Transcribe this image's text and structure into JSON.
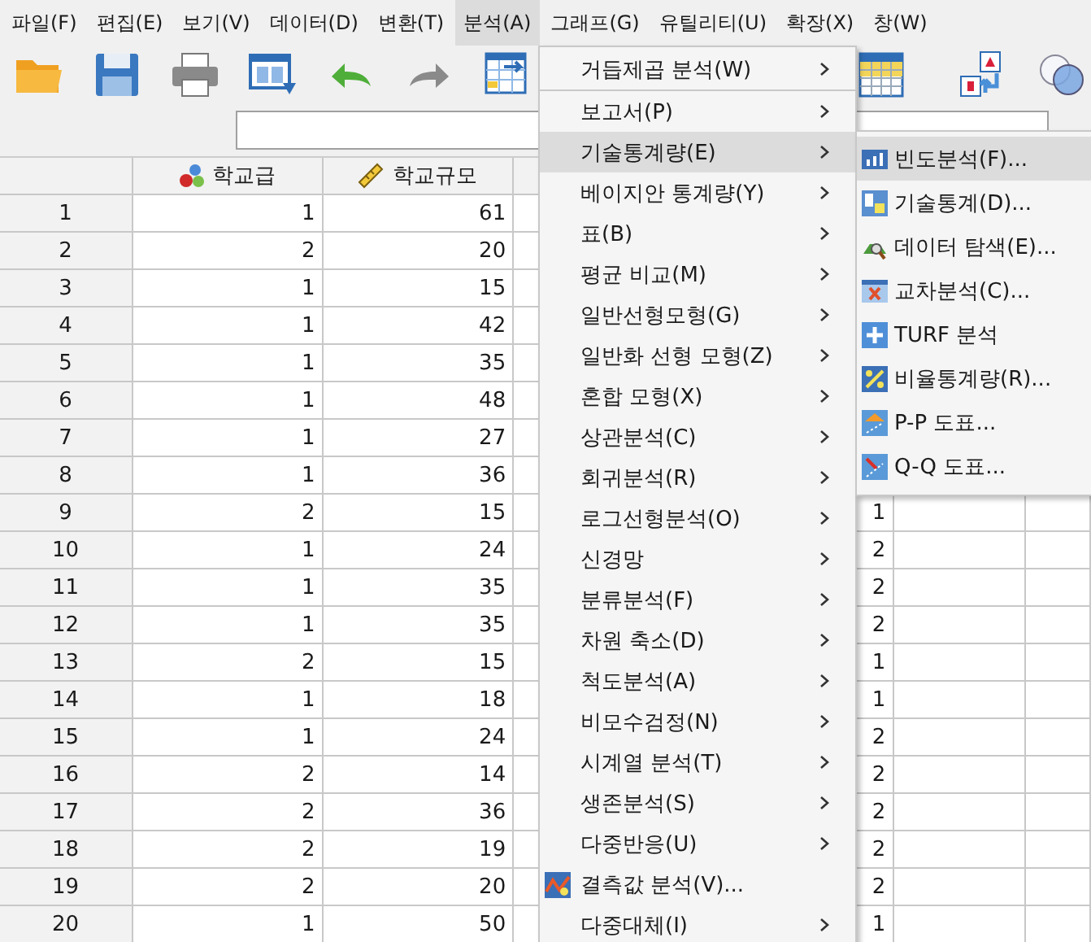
{
  "menu_bar": [
    {
      "label": "파일(F)",
      "selected": false
    },
    {
      "label": "편집(E)",
      "selected": false
    },
    {
      "label": "보기(V)",
      "selected": false
    },
    {
      "label": "데이터(D)",
      "selected": false
    },
    {
      "label": "변환(T)",
      "selected": false
    },
    {
      "label": "분석(A)",
      "selected": true
    },
    {
      "label": "그래프(G)",
      "selected": false
    },
    {
      "label": "유틸리티(U)",
      "selected": false
    },
    {
      "label": "확장(X)",
      "selected": false
    },
    {
      "label": "창(W)",
      "selected": false
    }
  ],
  "grid": {
    "columns": [
      {
        "name": "학교급",
        "kind": "nominal"
      },
      {
        "name": "학교규모",
        "kind": "scale"
      }
    ],
    "rows": [
      {
        "number": "1",
        "cells": [
          "1",
          "61"
        ]
      },
      {
        "number": "2",
        "cells": [
          "2",
          "20"
        ]
      },
      {
        "number": "3",
        "cells": [
          "1",
          "15"
        ]
      },
      {
        "number": "4",
        "cells": [
          "1",
          "42"
        ]
      },
      {
        "number": "5",
        "cells": [
          "1",
          "35"
        ]
      },
      {
        "number": "6",
        "cells": [
          "1",
          "48"
        ]
      },
      {
        "number": "7",
        "cells": [
          "1",
          "27"
        ]
      },
      {
        "number": "8",
        "cells": [
          "1",
          "36"
        ]
      },
      {
        "number": "9",
        "cells": [
          "2",
          "15"
        ],
        "column_4": "1"
      },
      {
        "number": "10",
        "cells": [
          "1",
          "24"
        ],
        "column_4": "2"
      },
      {
        "number": "11",
        "cells": [
          "1",
          "35"
        ],
        "column_4": "2"
      },
      {
        "number": "12",
        "cells": [
          "1",
          "35"
        ],
        "column_4": "2"
      },
      {
        "number": "13",
        "cells": [
          "2",
          "15"
        ],
        "column_4": "1"
      },
      {
        "number": "14",
        "cells": [
          "1",
          "18"
        ],
        "column_4": "1"
      },
      {
        "number": "15",
        "cells": [
          "1",
          "24"
        ],
        "column_4": "2"
      },
      {
        "number": "16",
        "cells": [
          "2",
          "14"
        ],
        "column_4": "2"
      },
      {
        "number": "17",
        "cells": [
          "2",
          "36"
        ],
        "column_4": "2"
      },
      {
        "number": "18",
        "cells": [
          "2",
          "19"
        ],
        "column_4": "2"
      },
      {
        "number": "19",
        "cells": [
          "2",
          "20"
        ],
        "column_4": "2"
      },
      {
        "number": "20",
        "cells": [
          "1",
          "50"
        ],
        "column_4": "1"
      }
    ]
  },
  "analyze_menu": {
    "sections": [
      [
        {
          "label": "거듭제곱 분석(W)",
          "submenu": true,
          "selected": false
        }
      ],
      [
        {
          "label": "보고서(P)",
          "submenu": true,
          "selected": false
        },
        {
          "label": "기술통계량(E)",
          "submenu": true,
          "selected": true
        },
        {
          "label": "베이지안 통계량(Y)",
          "submenu": true,
          "selected": false
        },
        {
          "label": "표(B)",
          "submenu": true,
          "selected": false
        },
        {
          "label": "평균 비교(M)",
          "submenu": true,
          "selected": false
        },
        {
          "label": "일반선형모형(G)",
          "submenu": true,
          "selected": false
        },
        {
          "label": "일반화 선형 모형(Z)",
          "submenu": true,
          "selected": false
        },
        {
          "label": "혼합 모형(X)",
          "submenu": true,
          "selected": false
        },
        {
          "label": "상관분석(C)",
          "submenu": true,
          "selected": false
        },
        {
          "label": "회귀분석(R)",
          "submenu": true,
          "selected": false
        },
        {
          "label": "로그선형분석(O)",
          "submenu": true,
          "selected": false
        },
        {
          "label": "신경망",
          "submenu": true,
          "selected": false
        },
        {
          "label": "분류분석(F)",
          "submenu": true,
          "selected": false
        },
        {
          "label": "차원 축소(D)",
          "submenu": true,
          "selected": false
        },
        {
          "label": "척도분석(A)",
          "submenu": true,
          "selected": false
        },
        {
          "label": "비모수검정(N)",
          "submenu": true,
          "selected": false
        },
        {
          "label": "시계열 분석(T)",
          "submenu": true,
          "selected": false
        },
        {
          "label": "생존분석(S)",
          "submenu": true,
          "selected": false
        },
        {
          "label": "다중반응(U)",
          "submenu": true,
          "selected": false
        },
        {
          "label": "결측값 분석(V)...",
          "submenu": false,
          "selected": false,
          "kind": "missing"
        },
        {
          "label": "다중대체(I)",
          "submenu": true,
          "selected": false
        }
      ]
    ]
  },
  "descriptives_submenu": {
    "items": [
      {
        "label": "빈도분석(F)...",
        "kind": "frequencies",
        "selected": true
      },
      {
        "label": "기술통계(D)...",
        "kind": "descriptives",
        "selected": false
      },
      {
        "label": "데이터 탐색(E)...",
        "kind": "explore",
        "selected": false
      },
      {
        "label": "교차분석(C)...",
        "kind": "crosstabs",
        "selected": false
      },
      {
        "label": "TURF 분석",
        "kind": "turf",
        "selected": false
      },
      {
        "label": "비율통계량(R)...",
        "kind": "ratio",
        "selected": false
      },
      {
        "label": "P-P 도표...",
        "kind": "pp",
        "selected": false
      },
      {
        "label": "Q-Q 도표...",
        "kind": "qq",
        "selected": false
      }
    ]
  }
}
